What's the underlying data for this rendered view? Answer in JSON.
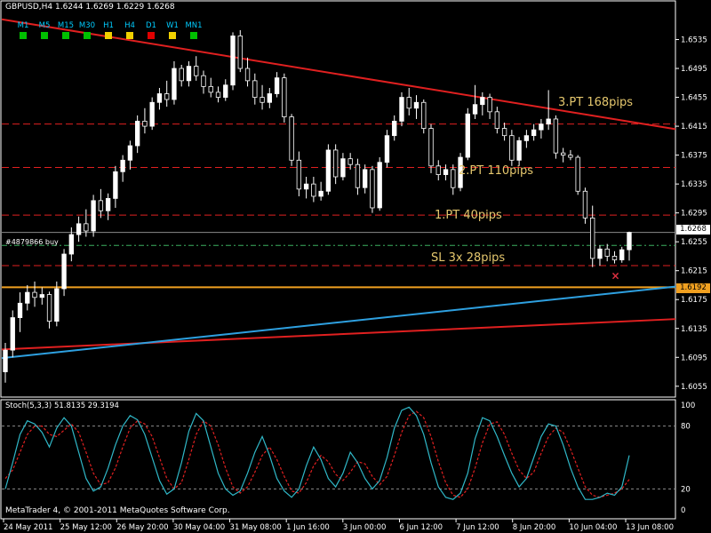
{
  "window": {
    "header": "GBPUSD,H4  1.6244 1.6269 1.6229 1.6268",
    "copyright": "MetaTrader 4, © 2001-2011 MetaQuotes Software Corp."
  },
  "timeframes": [
    {
      "label": "M1",
      "status": "#00c000"
    },
    {
      "label": "M5",
      "status": "#00c000"
    },
    {
      "label": "M15",
      "status": "#00c000"
    },
    {
      "label": "M30",
      "status": "#00c000"
    },
    {
      "label": "H1",
      "status": "#f0d000"
    },
    {
      "label": "H4",
      "status": "#f0d000"
    },
    {
      "label": "D1",
      "status": "#e00000"
    },
    {
      "label": "W1",
      "status": "#f0d000"
    },
    {
      "label": "MN1",
      "status": "#00c000"
    }
  ],
  "order": {
    "label": "#4879866 buy"
  },
  "indicator": {
    "label": "Stoch(5,3,3) 51.8135 29.3194",
    "levels": [
      100,
      80,
      20,
      0
    ],
    "main_color": "#30b8c8",
    "signal_color": "#e02020"
  },
  "targets": {
    "pt3": "3.PT 168pips",
    "pt2": "2.PT 110pips",
    "pt1": "1.PT 40pips",
    "sl": "SL 3x 28pips"
  },
  "price_tags": {
    "current": "1.6268",
    "support": "1.6192"
  },
  "colors": {
    "bull_candle": "#ffffff",
    "bear_candle": "#000000",
    "wick": "#ffffff",
    "trend_line": "#e02020",
    "blue_line": "#2ea0e0",
    "orange_line": "#f0a020",
    "target_label": "#e6c86e"
  },
  "chart_data": {
    "type": "candlestick",
    "symbol": "GBPUSD",
    "timeframe": "H4",
    "ylim": [
      1.604,
      1.6575
    ],
    "y_ticks": [
      1.6535,
      1.6495,
      1.6455,
      1.6415,
      1.6375,
      1.6335,
      1.6295,
      1.6255,
      1.6215,
      1.6175,
      1.6135,
      1.6095,
      1.6055
    ],
    "x_ticks": [
      "24 May 2011",
      "25 May 12:00",
      "26 May 20:00",
      "30 May 04:00",
      "31 May 08:00",
      "1 Jun 16:00",
      "3 Jun 00:00",
      "6 Jun 12:00",
      "7 Jun 12:00",
      "8 Jun 20:00",
      "10 Jun 04:00",
      "13 Jun 08:00"
    ],
    "candles": [
      [
        1.6075,
        1.6115,
        1.606,
        1.6105
      ],
      [
        1.6105,
        1.616,
        1.6095,
        1.615
      ],
      [
        1.615,
        1.6185,
        1.613,
        1.617
      ],
      [
        1.617,
        1.6195,
        1.616,
        1.6185
      ],
      [
        1.6185,
        1.62,
        1.6165,
        1.6178
      ],
      [
        1.6178,
        1.6192,
        1.6168,
        1.6182
      ],
      [
        1.6182,
        1.6186,
        1.6135,
        1.6145
      ],
      [
        1.6145,
        1.62,
        1.6138,
        1.619
      ],
      [
        1.619,
        1.6245,
        1.618,
        1.6238
      ],
      [
        1.6238,
        1.6275,
        1.6228,
        1.6265
      ],
      [
        1.6265,
        1.629,
        1.6255,
        1.628
      ],
      [
        1.628,
        1.63,
        1.6262,
        1.627
      ],
      [
        1.627,
        1.632,
        1.6262,
        1.6312
      ],
      [
        1.6312,
        1.6328,
        1.6288,
        1.6298
      ],
      [
        1.6298,
        1.6322,
        1.6285,
        1.6315
      ],
      [
        1.6315,
        1.636,
        1.6302,
        1.6352
      ],
      [
        1.6352,
        1.6375,
        1.6338,
        1.6368
      ],
      [
        1.6368,
        1.6395,
        1.6355,
        1.6388
      ],
      [
        1.6388,
        1.643,
        1.6378,
        1.6422
      ],
      [
        1.6422,
        1.644,
        1.6405,
        1.6415
      ],
      [
        1.6415,
        1.6455,
        1.641,
        1.6448
      ],
      [
        1.6448,
        1.6468,
        1.6438,
        1.646
      ],
      [
        1.646,
        1.6478,
        1.6442,
        1.6452
      ],
      [
        1.6452,
        1.6505,
        1.6445,
        1.6495
      ],
      [
        1.6495,
        1.65,
        1.647,
        1.6478
      ],
      [
        1.6478,
        1.6505,
        1.647,
        1.6498
      ],
      [
        1.6498,
        1.6512,
        1.6478,
        1.6485
      ],
      [
        1.6485,
        1.6492,
        1.646,
        1.647
      ],
      [
        1.647,
        1.6482,
        1.6455,
        1.6462
      ],
      [
        1.6462,
        1.647,
        1.6448,
        1.6455
      ],
      [
        1.6455,
        1.648,
        1.645,
        1.6472
      ],
      [
        1.6472,
        1.6545,
        1.6465,
        1.654
      ],
      [
        1.654,
        1.6548,
        1.649,
        1.6495
      ],
      [
        1.6495,
        1.651,
        1.647,
        1.6478
      ],
      [
        1.6478,
        1.6488,
        1.6445,
        1.6455
      ],
      [
        1.6455,
        1.6472,
        1.6438,
        1.6448
      ],
      [
        1.6448,
        1.6468,
        1.644,
        1.646
      ],
      [
        1.646,
        1.649,
        1.6455,
        1.6482
      ],
      [
        1.6482,
        1.6488,
        1.642,
        1.6428
      ],
      [
        1.6428,
        1.6432,
        1.636,
        1.6368
      ],
      [
        1.6368,
        1.638,
        1.6318,
        1.6328
      ],
      [
        1.6328,
        1.6345,
        1.6315,
        1.6335
      ],
      [
        1.6335,
        1.6345,
        1.631,
        1.6318
      ],
      [
        1.6318,
        1.6338,
        1.6312,
        1.6325
      ],
      [
        1.6325,
        1.639,
        1.632,
        1.6382
      ],
      [
        1.6382,
        1.639,
        1.6335,
        1.6345
      ],
      [
        1.6345,
        1.6378,
        1.634,
        1.637
      ],
      [
        1.637,
        1.6378,
        1.6355,
        1.6362
      ],
      [
        1.6362,
        1.637,
        1.632,
        1.633
      ],
      [
        1.633,
        1.6362,
        1.6322,
        1.6355
      ],
      [
        1.6355,
        1.636,
        1.6295,
        1.6302
      ],
      [
        1.6302,
        1.6372,
        1.6298,
        1.6365
      ],
      [
        1.6365,
        1.641,
        1.6358,
        1.6402
      ],
      [
        1.6402,
        1.643,
        1.6395,
        1.6422
      ],
      [
        1.6422,
        1.6462,
        1.6415,
        1.6455
      ],
      [
        1.6455,
        1.6468,
        1.643,
        1.644
      ],
      [
        1.644,
        1.6458,
        1.6425,
        1.6448
      ],
      [
        1.6448,
        1.6452,
        1.6405,
        1.6412
      ],
      [
        1.6412,
        1.6418,
        1.635,
        1.636
      ],
      [
        1.636,
        1.6368,
        1.634,
        1.6348
      ],
      [
        1.6348,
        1.6362,
        1.634,
        1.6355
      ],
      [
        1.6355,
        1.6362,
        1.632,
        1.633
      ],
      [
        1.633,
        1.6378,
        1.6325,
        1.6372
      ],
      [
        1.6372,
        1.644,
        1.6368,
        1.6432
      ],
      [
        1.6432,
        1.6472,
        1.6425,
        1.6445
      ],
      [
        1.6445,
        1.6462,
        1.643,
        1.6455
      ],
      [
        1.6455,
        1.646,
        1.6425,
        1.6435
      ],
      [
        1.6435,
        1.6442,
        1.6405,
        1.6412
      ],
      [
        1.6412,
        1.642,
        1.6395,
        1.6402
      ],
      [
        1.6402,
        1.641,
        1.636,
        1.6368
      ],
      [
        1.6368,
        1.64,
        1.636,
        1.6395
      ],
      [
        1.6395,
        1.641,
        1.6385,
        1.6402
      ],
      [
        1.6402,
        1.6418,
        1.6395,
        1.641
      ],
      [
        1.641,
        1.6425,
        1.6398,
        1.6418
      ],
      [
        1.6418,
        1.6465,
        1.641,
        1.6425
      ],
      [
        1.6425,
        1.643,
        1.637,
        1.6378
      ],
      [
        1.6378,
        1.6385,
        1.6365,
        1.6375
      ],
      [
        1.6375,
        1.6382,
        1.6368,
        1.6372
      ],
      [
        1.6372,
        1.6375,
        1.632,
        1.6325
      ],
      [
        1.6325,
        1.633,
        1.628,
        1.6288
      ],
      [
        1.6288,
        1.6305,
        1.622,
        1.6232
      ],
      [
        1.6232,
        1.625,
        1.6222,
        1.6245
      ],
      [
        1.6245,
        1.6252,
        1.6228,
        1.6235
      ],
      [
        1.6235,
        1.6242,
        1.6225,
        1.623
      ],
      [
        1.623,
        1.6248,
        1.6226,
        1.6244
      ],
      [
        1.6244,
        1.6269,
        1.6229,
        1.6268
      ]
    ],
    "lines": {
      "resistance_trend": {
        "color": "#e02020",
        "from": 1.6563,
        "to": 1.6411
      },
      "lower_red_trend": {
        "color": "#e02020",
        "from": 1.6106,
        "to": 1.6148
      },
      "blue_support_trend": {
        "color": "#2ea0e0",
        "from": 1.6094,
        "to": 1.6193
      },
      "orange_level": {
        "color": "#f0a020",
        "price": 1.6192
      },
      "current_price": {
        "price": 1.6268
      },
      "levels": [
        {
          "name": "3.PT",
          "price": 1.6418
        },
        {
          "name": "2.PT",
          "price": 1.6358
        },
        {
          "name": "1.PT",
          "price": 1.6292
        },
        {
          "name": "order",
          "price": 1.625
        },
        {
          "name": "SL",
          "price": 1.6222
        }
      ]
    },
    "stochastic": {
      "ylim": [
        0,
        100
      ],
      "levels": [
        80,
        20
      ],
      "main": [
        20,
        45,
        72,
        85,
        82,
        74,
        60,
        78,
        88,
        80,
        55,
        30,
        18,
        22,
        40,
        62,
        80,
        90,
        86,
        72,
        50,
        28,
        15,
        20,
        45,
        75,
        92,
        85,
        60,
        35,
        20,
        14,
        18,
        35,
        55,
        70,
        52,
        30,
        18,
        12,
        20,
        42,
        60,
        48,
        30,
        22,
        35,
        55,
        45,
        30,
        20,
        28,
        50,
        78,
        95,
        98,
        90,
        72,
        45,
        22,
        12,
        10,
        16,
        35,
        68,
        88,
        85,
        70,
        52,
        35,
        22,
        30,
        50,
        70,
        82,
        80,
        62,
        40,
        22,
        10,
        10,
        12,
        16,
        14,
        22,
        52
      ],
      "signal": [
        30,
        38,
        55,
        72,
        80,
        80,
        72,
        70,
        76,
        82,
        74,
        55,
        35,
        24,
        26,
        40,
        60,
        78,
        85,
        82,
        70,
        50,
        30,
        20,
        26,
        48,
        72,
        85,
        80,
        62,
        40,
        22,
        16,
        22,
        36,
        52,
        60,
        48,
        32,
        18,
        16,
        26,
        42,
        52,
        46,
        34,
        28,
        36,
        46,
        44,
        32,
        24,
        32,
        52,
        74,
        90,
        94,
        88,
        70,
        46,
        26,
        14,
        12,
        20,
        40,
        64,
        82,
        84,
        72,
        54,
        38,
        30,
        36,
        54,
        70,
        78,
        74,
        58,
        40,
        22,
        14,
        12,
        14,
        16,
        20,
        29
      ]
    }
  }
}
